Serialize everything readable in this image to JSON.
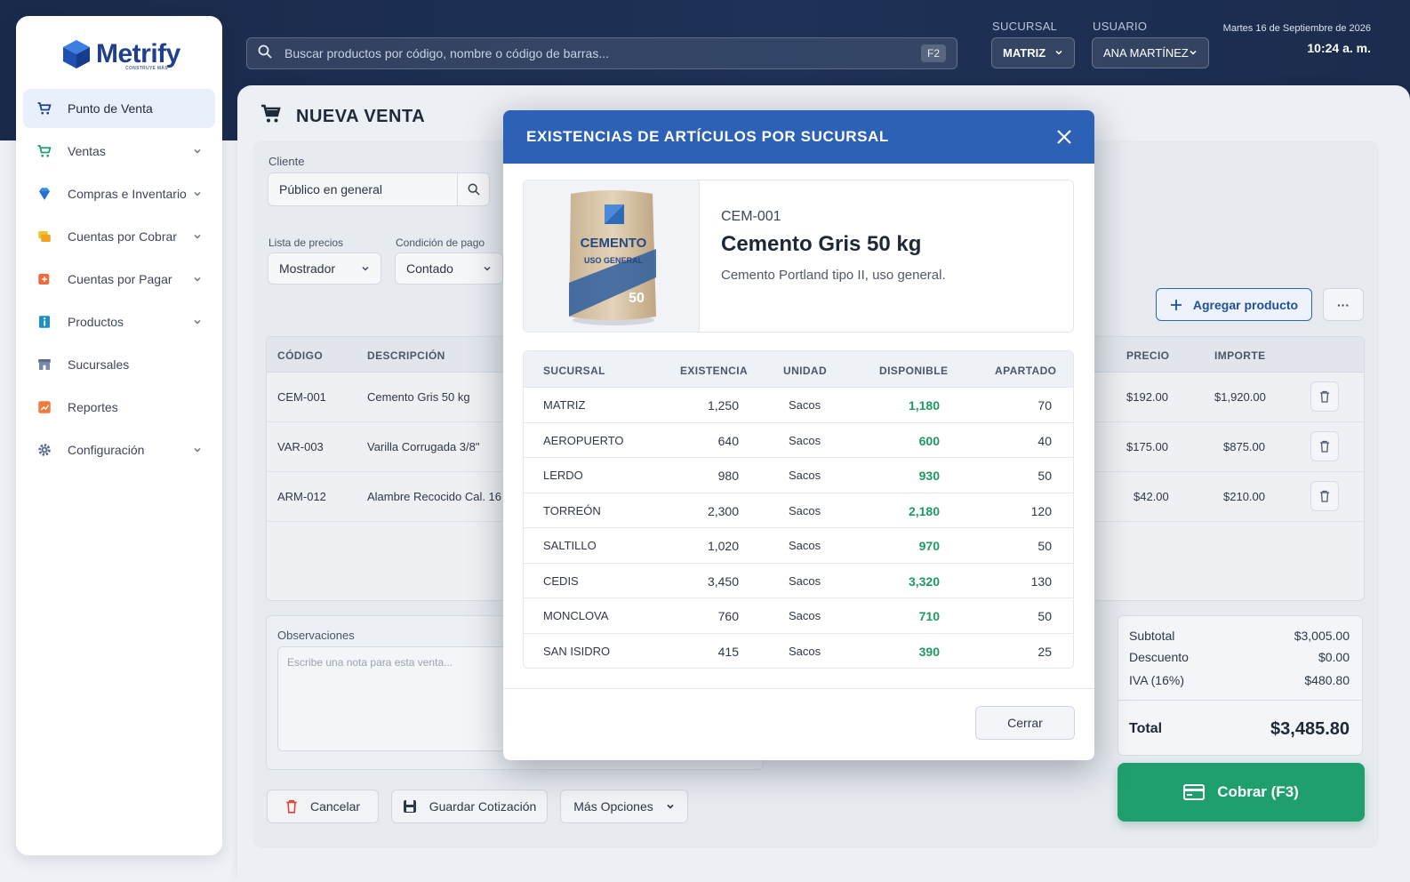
{
  "app": {
    "logo_text": "Metrify",
    "logo_sub": "CONSTRUYE MÁS"
  },
  "sidebar": {
    "items": [
      {
        "label": "Punto de Venta",
        "icon": "cart-icon",
        "active": true
      },
      {
        "label": "Ventas",
        "icon": "cart-icon"
      },
      {
        "label": "Compras e Inventario",
        "icon": "diamond-icon"
      },
      {
        "label": "Cuentas por Cobrar",
        "icon": "receivable-icon"
      },
      {
        "label": "Cuentas por Pagar",
        "icon": "payable-icon"
      },
      {
        "label": "Productos",
        "icon": "info-icon"
      },
      {
        "label": "Sucursales",
        "icon": "store-icon"
      },
      {
        "label": "Reportes",
        "icon": "report-icon"
      },
      {
        "label": "Configuración",
        "icon": "gear-icon"
      }
    ]
  },
  "header": {
    "search_placeholder": "Buscar productos por código, nombre o código de barras...",
    "search_shortcut": "F2",
    "sucursal_label": "SUCURSAL",
    "sucursal_value": "MATRIZ",
    "usuario_label": "USUARIO",
    "usuario_value": "ANA MARTÍNEZ",
    "date": "Martes 16 de Septiembre de 2026",
    "time": "10:24 a. m."
  },
  "sale": {
    "title": "NUEVA VENTA",
    "cliente_label": "Cliente",
    "cliente_value": "Público en general",
    "lista_label": "Lista de precios",
    "lista_value": "Mostrador",
    "condicion_label": "Condición de pago",
    "condicion_value": "Contado",
    "add_product": "Agregar producto",
    "more": "···",
    "columns": {
      "codigo": "CÓDIGO",
      "descripcion": "DESCRIPCIÓN",
      "precio": "PRECIO",
      "importe": "IMPORTE"
    },
    "rows": [
      {
        "codigo": "CEM-001",
        "descripcion": "Cemento Gris 50 kg",
        "precio": "$192.00",
        "importe": "$1,920.00"
      },
      {
        "codigo": "VAR-003",
        "descripcion": "Varilla Corrugada 3/8\"",
        "precio": "$175.00",
        "importe": "$875.00"
      },
      {
        "codigo": "ARM-012",
        "descripcion": "Alambre Recocido Cal. 16",
        "precio": "$42.00",
        "importe": "$210.00"
      }
    ],
    "observaciones_label": "Observaciones",
    "observaciones_placeholder": "Escribe una nota para esta venta...",
    "totals": {
      "subtotal_label": "Subtotal",
      "subtotal": "$3,005.00",
      "descuento_label": "Descuento",
      "descuento": "$0.00",
      "iva_label": "IVA (16%)",
      "iva": "$480.80",
      "total_label": "Total",
      "total": "$3,485.80"
    },
    "cancel": "Cancelar",
    "save_quote": "Guardar Cotización",
    "more_options": "Más Opciones",
    "charge": "Cobrar (F3)"
  },
  "modal": {
    "title": "EXISTENCIAS DE ARTÍCULOS POR SUCURSAL",
    "product": {
      "code": "CEM-001",
      "name": "Cemento Gris 50 kg",
      "description": "Cemento Portland tipo II, uso general.",
      "bag_brand": "CEMENTO",
      "bag_sub": "USO GENERAL",
      "bag_weight": "50"
    },
    "columns": {
      "sucursal": "SUCURSAL",
      "existencia": "EXISTENCIA",
      "unidad": "UNIDAD",
      "disponible": "DISPONIBLE",
      "apartado": "APARTADO"
    },
    "rows": [
      {
        "sucursal": "MATRIZ",
        "existencia": "1,250",
        "unidad": "Sacos",
        "disponible": "1,180",
        "apartado": "70"
      },
      {
        "sucursal": "AEROPUERTO",
        "existencia": "640",
        "unidad": "Sacos",
        "disponible": "600",
        "apartado": "40"
      },
      {
        "sucursal": "LERDO",
        "existencia": "980",
        "unidad": "Sacos",
        "disponible": "930",
        "apartado": "50"
      },
      {
        "sucursal": "TORREÓN",
        "existencia": "2,300",
        "unidad": "Sacos",
        "disponible": "2,180",
        "apartado": "120"
      },
      {
        "sucursal": "SALTILLO",
        "existencia": "1,020",
        "unidad": "Sacos",
        "disponible": "970",
        "apartado": "50"
      },
      {
        "sucursal": "CEDIS",
        "existencia": "3,450",
        "unidad": "Sacos",
        "disponible": "3,320",
        "apartado": "130"
      },
      {
        "sucursal": "MONCLOVA",
        "existencia": "760",
        "unidad": "Sacos",
        "disponible": "710",
        "apartado": "50"
      },
      {
        "sucursal": "SAN ISIDRO",
        "existencia": "415",
        "unidad": "Sacos",
        "disponible": "390",
        "apartado": "25"
      }
    ],
    "close_label": "Cerrar"
  },
  "colors": {
    "primary": "#2c61b6",
    "success": "#1f9e6e",
    "header_dark": "#1a2a4a"
  }
}
